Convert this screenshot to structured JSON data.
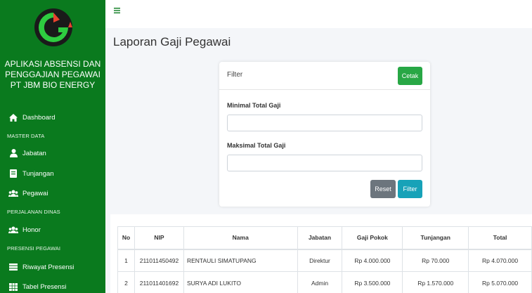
{
  "app": {
    "brand_lines": [
      "APLIKASI ABSENSI DAN",
      "PENGGAJIAN PEGAWAI",
      "PT JBM BIO ENERGY"
    ]
  },
  "colors": {
    "sidebar": "#0a7a1e",
    "primary": "#28a745",
    "info": "#17a2b8",
    "secondary": "#6c757d"
  },
  "sidebar": {
    "dashboard": {
      "label": "Dashboard",
      "icon": "home-icon"
    },
    "master_data": "MASTER DATA",
    "jabatan": {
      "label": "Jabatan",
      "icon": "user-tie-icon"
    },
    "tunjangan": {
      "label": "Tunjangan",
      "icon": "book-icon"
    },
    "pegawai": {
      "label": "Pegawai",
      "icon": "users-icon"
    },
    "perjalanan_dinas": "PERJALANAN DINAS",
    "honor": {
      "label": "Honor",
      "icon": "users-icon"
    },
    "presensi_pegawai": "PRESENSI PEGAWAI",
    "riwayat_presensi": {
      "label": "Riwayat Presensi",
      "icon": "table-list-icon"
    },
    "tabel_presensi": {
      "label": "Tabel Presensi",
      "icon": "table-grid-icon"
    }
  },
  "topbar": {
    "menu_icon": "hamburger-icon"
  },
  "page": {
    "title": "Laporan Gaji Pegawai"
  },
  "filter_card": {
    "title": "Filter",
    "cetak_label": "Cetak",
    "min_label": "Minimal Total Gaji",
    "min_value": "",
    "max_label": "Maksimal Total Gaji",
    "max_value": "",
    "reset_label": "Reset",
    "filter_label": "Filter"
  },
  "table": {
    "headers": [
      "No",
      "NIP",
      "Nama",
      "Jabatan",
      "Gaji Pokok",
      "Tunjangan",
      "Total"
    ],
    "rows": [
      [
        "1",
        "211011450492",
        "RENTAULI SIMATUPANG",
        "Direktur",
        "Rp 4.000.000",
        "Rp 70.000",
        "Rp 4.070.000"
      ],
      [
        "2",
        "211011401692",
        "SURYA ADI LUKITO",
        "Admin",
        "Rp 3.500.000",
        "Rp 1.570.000",
        "Rp 5.070.000"
      ]
    ]
  }
}
